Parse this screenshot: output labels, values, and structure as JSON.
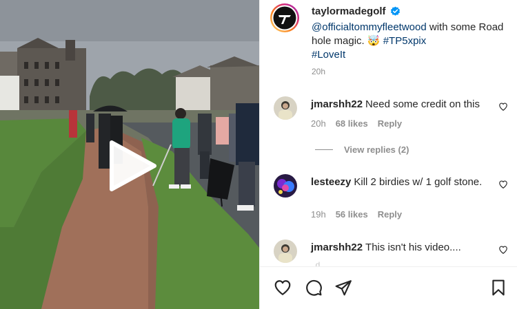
{
  "post": {
    "author": "taylormadegolf",
    "caption": {
      "mention": "@officialtommyfleetwood",
      "text": " with some Road hole magic. 🤯 ",
      "hashtag1": "#TP5xpix",
      "hashtag2": "#LoveIt"
    },
    "time": "20h"
  },
  "comments": [
    {
      "user": "jmarshh22",
      "text": "Need some credit on this",
      "time": "20h",
      "likes": "68 likes",
      "reply": "Reply"
    },
    {
      "user": "lesteezy",
      "text": "Kill 2 birdies w/ 1 golf stone.",
      "time": "19h",
      "likes": "56 likes",
      "reply": "Reply"
    },
    {
      "user": "jmarshh22",
      "text": "This isn't his video...."
    }
  ],
  "view_replies": "View replies (2)",
  "faded_text": "..d ... .. ... ...",
  "icons": {
    "verified": "verified-badge-icon",
    "like": "heart-icon",
    "comment": "comment-icon",
    "share": "paper-plane-icon",
    "save": "bookmark-icon",
    "play": "play-icon"
  },
  "colors": {
    "link": "#00376b",
    "verified": "#0095f6",
    "muted": "#8e8e8e"
  }
}
